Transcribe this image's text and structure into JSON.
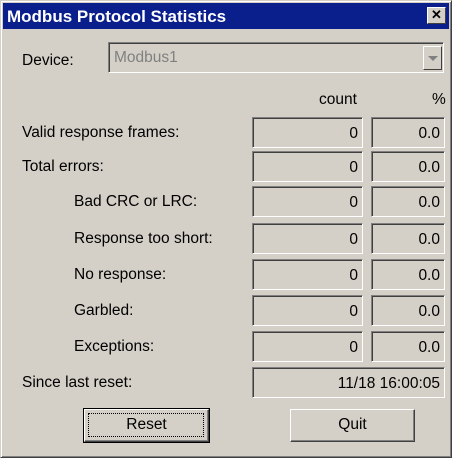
{
  "window": {
    "title": "Modbus Protocol Statistics",
    "close_label": "✕"
  },
  "device": {
    "label": "Device:",
    "value": "Modbus1"
  },
  "columns": {
    "count": "count",
    "percent": "%"
  },
  "rows": [
    {
      "label": "Valid response frames:",
      "count": "0",
      "percent": "0.0"
    },
    {
      "label": "Total errors:",
      "count": "0",
      "percent": "0.0"
    },
    {
      "label": "Bad CRC or LRC:",
      "count": "0",
      "percent": "0.0"
    },
    {
      "label": "Response too short:",
      "count": "0",
      "percent": "0.0"
    },
    {
      "label": "No response:",
      "count": "0",
      "percent": "0.0"
    },
    {
      "label": "Garbled:",
      "count": "0",
      "percent": "0.0"
    },
    {
      "label": "Exceptions:",
      "count": "0",
      "percent": "0.0"
    }
  ],
  "since_reset": {
    "label": "Since last reset:",
    "value": "11/18 16:00:05"
  },
  "buttons": {
    "reset": "Reset",
    "quit": "Quit"
  },
  "colors": {
    "titlebar": "#0a1e8c",
    "face": "#d4d0c8"
  }
}
